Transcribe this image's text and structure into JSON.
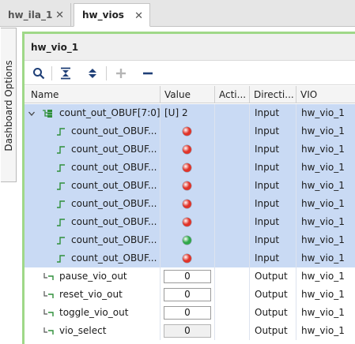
{
  "tabs": [
    {
      "label": "hw_ila_1",
      "close": "✕",
      "active": false
    },
    {
      "label": "hw_vios",
      "close": "✕",
      "active": true
    }
  ],
  "sidebar": {
    "label": "Dashboard Options"
  },
  "panel": {
    "title": "hw_vio_1"
  },
  "toolbar": {
    "buttons": [
      "search-icon",
      "collapse-all-icon",
      "expand-all-icon",
      "add-icon",
      "remove-icon"
    ]
  },
  "columns": [
    "Name",
    "Value",
    "Acti...",
    "Directi...",
    "VIO"
  ],
  "rows": [
    {
      "name": "count_out_OBUF[7:0]",
      "value": "[U] 2",
      "activity": "",
      "direction": "Input",
      "vio": "hw_vio_1",
      "kind": "bus",
      "selected": true
    },
    {
      "name": "count_out_OBUF...",
      "led": "red",
      "direction": "Input",
      "vio": "hw_vio_1",
      "kind": "probe",
      "selected": true
    },
    {
      "name": "count_out_OBUF...",
      "led": "red",
      "direction": "Input",
      "vio": "hw_vio_1",
      "kind": "probe",
      "selected": true
    },
    {
      "name": "count_out_OBUF...",
      "led": "red",
      "direction": "Input",
      "vio": "hw_vio_1",
      "kind": "probe",
      "selected": true
    },
    {
      "name": "count_out_OBUF...",
      "led": "red",
      "direction": "Input",
      "vio": "hw_vio_1",
      "kind": "probe",
      "selected": true
    },
    {
      "name": "count_out_OBUF...",
      "led": "red",
      "direction": "Input",
      "vio": "hw_vio_1",
      "kind": "probe",
      "selected": true
    },
    {
      "name": "count_out_OBUF...",
      "led": "red",
      "direction": "Input",
      "vio": "hw_vio_1",
      "kind": "probe",
      "selected": true
    },
    {
      "name": "count_out_OBUF...",
      "led": "green",
      "direction": "Input",
      "vio": "hw_vio_1",
      "kind": "probe",
      "selected": true
    },
    {
      "name": "count_out_OBUF...",
      "led": "red",
      "direction": "Input",
      "vio": "hw_vio_1",
      "kind": "probe",
      "selected": true
    },
    {
      "name": "pause_vio_out",
      "value": "0",
      "direction": "Output",
      "vio": "hw_vio_1",
      "kind": "out",
      "selected": false,
      "disabled": false
    },
    {
      "name": "reset_vio_out",
      "value": "0",
      "direction": "Output",
      "vio": "hw_vio_1",
      "kind": "out",
      "selected": false,
      "disabled": false
    },
    {
      "name": "toggle_vio_out",
      "value": "0",
      "direction": "Output",
      "vio": "hw_vio_1",
      "kind": "out",
      "selected": false,
      "disabled": false
    },
    {
      "name": "vio_select",
      "value": "0",
      "direction": "Output",
      "vio": "hw_vio_1",
      "kind": "out",
      "selected": false,
      "disabled": true
    }
  ],
  "colors": {
    "led_red": "#e0342a",
    "led_green": "#2fa84a",
    "selection": "#c9daf4",
    "panel_border": "#9fd888"
  }
}
